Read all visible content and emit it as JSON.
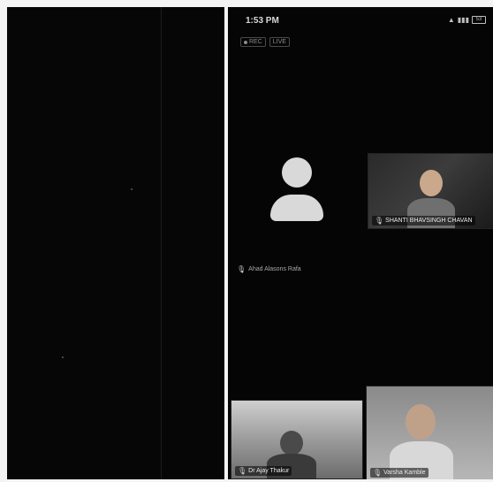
{
  "status_bar": {
    "time": "1:53 PM",
    "battery": "53"
  },
  "badges": {
    "rec": "REC",
    "live": "LIVE"
  },
  "self_view": {
    "name": "Ahad Alasons Rafa"
  },
  "participants": [
    {
      "name": "SHANTI BHAVSINGH CHAVAN"
    },
    {
      "name": "Dr Ajay Thakur"
    },
    {
      "name": "Varsha Kamble"
    }
  ],
  "icons": [
    "mic-icon",
    "wifi-icon",
    "signal-icon",
    "battery-icon",
    "record-dot-icon",
    "avatar-icon"
  ],
  "colors": {
    "background": "#050505",
    "avatar": "#d9d9d9"
  }
}
